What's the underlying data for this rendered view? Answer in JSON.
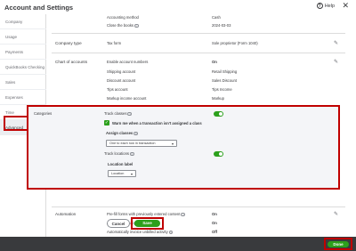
{
  "header": {
    "title": "Account and Settings",
    "help_label": "Help",
    "help_icon": "?",
    "close_icon": "✕"
  },
  "sidebar": {
    "items": [
      {
        "label": "Company"
      },
      {
        "label": "Usage"
      },
      {
        "label": "Payments"
      },
      {
        "label": "QuickBooks Checking"
      },
      {
        "label": "Sales"
      },
      {
        "label": "Expenses"
      },
      {
        "label": "Time"
      },
      {
        "label": "Advanced"
      }
    ],
    "active": "Advanced"
  },
  "accounting": {
    "method_label": "Accounting method",
    "method_value": "Cash",
    "close_label": "Close the books",
    "close_value": "2024-03-03"
  },
  "company_type": {
    "section": "Company type",
    "tax_form_label": "Tax form",
    "tax_form_value": "Sole proprietor (Form 1040)"
  },
  "chart_of_accounts": {
    "section": "Chart of accounts",
    "rows": [
      {
        "label": "Enable account numbers",
        "value": "On"
      },
      {
        "label": "Shipping account",
        "value": "Retail Shipping"
      },
      {
        "label": "Discount account",
        "value": "Sales Discount"
      },
      {
        "label": "Tips account",
        "value": "Tips Income"
      },
      {
        "label": "Markup income account",
        "value": "Markup"
      },
      {
        "label": "Billable expense income account",
        "value": "Refunds to customers"
      }
    ]
  },
  "categories": {
    "section": "Categories",
    "track_classes": "Track classes",
    "warn_label": "Warn me when a transaction isn't assigned a class",
    "assign_classes_label": "Assign classes",
    "assign_classes_value": "One to each row in transaction",
    "track_locations": "Track locations",
    "location_label_title": "Location label",
    "location_label_value": "Location",
    "cancel": "Cancel",
    "save": "Save"
  },
  "automation": {
    "section": "Automation",
    "rows": [
      {
        "label": "Pre-fill forms with previously entered content",
        "value": "On"
      },
      {
        "label": "Automatically apply credits",
        "value": "On"
      },
      {
        "label": "Automatically invoice unbilled activity",
        "value": "Off"
      }
    ]
  },
  "footer": {
    "done": "Done"
  },
  "colors": {
    "accent": "#2ca01c",
    "highlight": "#c00000",
    "footer": "#393a3d"
  }
}
